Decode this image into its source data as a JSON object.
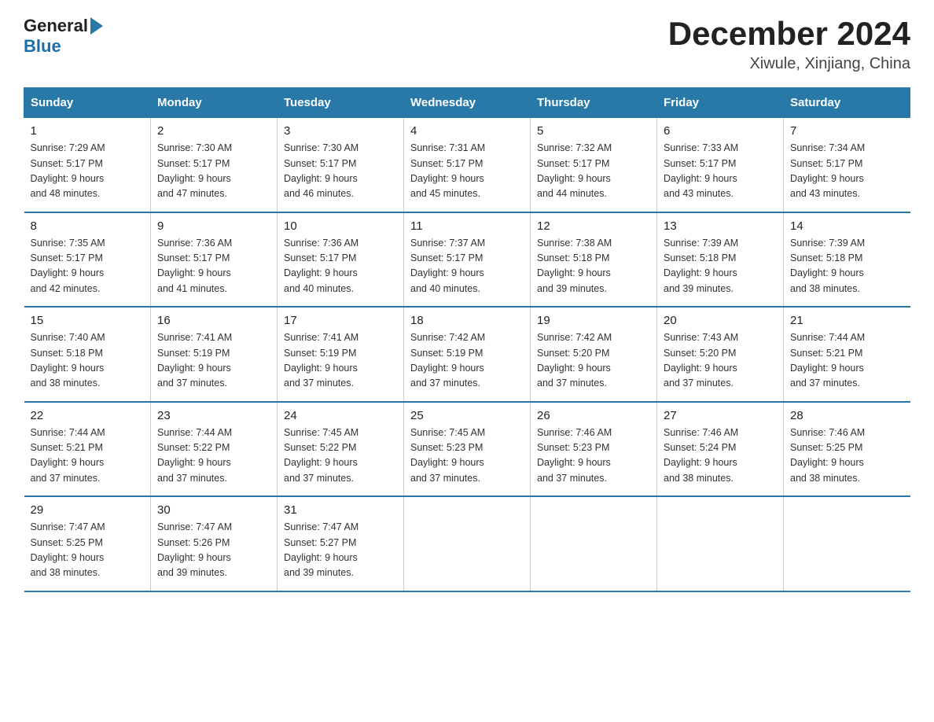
{
  "header": {
    "logo_general": "General",
    "logo_blue": "Blue",
    "title": "December 2024",
    "subtitle": "Xiwule, Xinjiang, China"
  },
  "calendar": {
    "days_of_week": [
      "Sunday",
      "Monday",
      "Tuesday",
      "Wednesday",
      "Thursday",
      "Friday",
      "Saturday"
    ],
    "weeks": [
      [
        {
          "day": "1",
          "sunrise": "7:29 AM",
          "sunset": "5:17 PM",
          "daylight": "9 hours and 48 minutes."
        },
        {
          "day": "2",
          "sunrise": "7:30 AM",
          "sunset": "5:17 PM",
          "daylight": "9 hours and 47 minutes."
        },
        {
          "day": "3",
          "sunrise": "7:30 AM",
          "sunset": "5:17 PM",
          "daylight": "9 hours and 46 minutes."
        },
        {
          "day": "4",
          "sunrise": "7:31 AM",
          "sunset": "5:17 PM",
          "daylight": "9 hours and 45 minutes."
        },
        {
          "day": "5",
          "sunrise": "7:32 AM",
          "sunset": "5:17 PM",
          "daylight": "9 hours and 44 minutes."
        },
        {
          "day": "6",
          "sunrise": "7:33 AM",
          "sunset": "5:17 PM",
          "daylight": "9 hours and 43 minutes."
        },
        {
          "day": "7",
          "sunrise": "7:34 AM",
          "sunset": "5:17 PM",
          "daylight": "9 hours and 43 minutes."
        }
      ],
      [
        {
          "day": "8",
          "sunrise": "7:35 AM",
          "sunset": "5:17 PM",
          "daylight": "9 hours and 42 minutes."
        },
        {
          "day": "9",
          "sunrise": "7:36 AM",
          "sunset": "5:17 PM",
          "daylight": "9 hours and 41 minutes."
        },
        {
          "day": "10",
          "sunrise": "7:36 AM",
          "sunset": "5:17 PM",
          "daylight": "9 hours and 40 minutes."
        },
        {
          "day": "11",
          "sunrise": "7:37 AM",
          "sunset": "5:17 PM",
          "daylight": "9 hours and 40 minutes."
        },
        {
          "day": "12",
          "sunrise": "7:38 AM",
          "sunset": "5:18 PM",
          "daylight": "9 hours and 39 minutes."
        },
        {
          "day": "13",
          "sunrise": "7:39 AM",
          "sunset": "5:18 PM",
          "daylight": "9 hours and 39 minutes."
        },
        {
          "day": "14",
          "sunrise": "7:39 AM",
          "sunset": "5:18 PM",
          "daylight": "9 hours and 38 minutes."
        }
      ],
      [
        {
          "day": "15",
          "sunrise": "7:40 AM",
          "sunset": "5:18 PM",
          "daylight": "9 hours and 38 minutes."
        },
        {
          "day": "16",
          "sunrise": "7:41 AM",
          "sunset": "5:19 PM",
          "daylight": "9 hours and 37 minutes."
        },
        {
          "day": "17",
          "sunrise": "7:41 AM",
          "sunset": "5:19 PM",
          "daylight": "9 hours and 37 minutes."
        },
        {
          "day": "18",
          "sunrise": "7:42 AM",
          "sunset": "5:19 PM",
          "daylight": "9 hours and 37 minutes."
        },
        {
          "day": "19",
          "sunrise": "7:42 AM",
          "sunset": "5:20 PM",
          "daylight": "9 hours and 37 minutes."
        },
        {
          "day": "20",
          "sunrise": "7:43 AM",
          "sunset": "5:20 PM",
          "daylight": "9 hours and 37 minutes."
        },
        {
          "day": "21",
          "sunrise": "7:44 AM",
          "sunset": "5:21 PM",
          "daylight": "9 hours and 37 minutes."
        }
      ],
      [
        {
          "day": "22",
          "sunrise": "7:44 AM",
          "sunset": "5:21 PM",
          "daylight": "9 hours and 37 minutes."
        },
        {
          "day": "23",
          "sunrise": "7:44 AM",
          "sunset": "5:22 PM",
          "daylight": "9 hours and 37 minutes."
        },
        {
          "day": "24",
          "sunrise": "7:45 AM",
          "sunset": "5:22 PM",
          "daylight": "9 hours and 37 minutes."
        },
        {
          "day": "25",
          "sunrise": "7:45 AM",
          "sunset": "5:23 PM",
          "daylight": "9 hours and 37 minutes."
        },
        {
          "day": "26",
          "sunrise": "7:46 AM",
          "sunset": "5:23 PM",
          "daylight": "9 hours and 37 minutes."
        },
        {
          "day": "27",
          "sunrise": "7:46 AM",
          "sunset": "5:24 PM",
          "daylight": "9 hours and 38 minutes."
        },
        {
          "day": "28",
          "sunrise": "7:46 AM",
          "sunset": "5:25 PM",
          "daylight": "9 hours and 38 minutes."
        }
      ],
      [
        {
          "day": "29",
          "sunrise": "7:47 AM",
          "sunset": "5:25 PM",
          "daylight": "9 hours and 38 minutes."
        },
        {
          "day": "30",
          "sunrise": "7:47 AM",
          "sunset": "5:26 PM",
          "daylight": "9 hours and 39 minutes."
        },
        {
          "day": "31",
          "sunrise": "7:47 AM",
          "sunset": "5:27 PM",
          "daylight": "9 hours and 39 minutes."
        },
        null,
        null,
        null,
        null
      ]
    ]
  }
}
